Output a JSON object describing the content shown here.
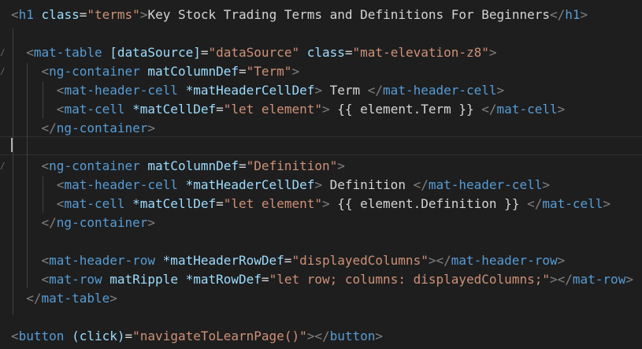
{
  "editor": {
    "theme": {
      "background": "#1e1e1e",
      "tag_color": "#569cd6",
      "attr_color": "#9cdcfe",
      "string_color": "#ce9178",
      "bracket_color": "#808080",
      "text_color": "#d4d4d4"
    },
    "gutter_icon": "fold-chevron-icon",
    "lines": [
      {
        "tokens": [
          {
            "t": "bracket",
            "v": "<"
          },
          {
            "t": "tag",
            "v": "h1"
          },
          {
            "t": "text",
            "v": " "
          },
          {
            "t": "attr",
            "v": "class"
          },
          {
            "t": "text",
            "v": "="
          },
          {
            "t": "str",
            "v": "\"terms\""
          },
          {
            "t": "bracket",
            "v": ">"
          },
          {
            "t": "text",
            "v": "Key Stock Trading Terms and Definitions For Beginners"
          },
          {
            "t": "bracket",
            "v": "</"
          },
          {
            "t": "tag",
            "v": "h1"
          },
          {
            "t": "bracket",
            "v": ">"
          }
        ]
      },
      {
        "tokens": []
      },
      {
        "tokens": [
          {
            "t": "text",
            "v": "  "
          },
          {
            "t": "bracket",
            "v": "<"
          },
          {
            "t": "tag",
            "v": "mat-table"
          },
          {
            "t": "text",
            "v": " "
          },
          {
            "t": "attr",
            "v": "[dataSource]"
          },
          {
            "t": "text",
            "v": "="
          },
          {
            "t": "str",
            "v": "\"dataSource\""
          },
          {
            "t": "text",
            "v": " "
          },
          {
            "t": "attr",
            "v": "class"
          },
          {
            "t": "text",
            "v": "="
          },
          {
            "t": "str",
            "v": "\"mat-elevation-z8\""
          },
          {
            "t": "bracket",
            "v": ">"
          }
        ]
      },
      {
        "tokens": [
          {
            "t": "text",
            "v": "    "
          },
          {
            "t": "bracket",
            "v": "<"
          },
          {
            "t": "tag",
            "v": "ng-container"
          },
          {
            "t": "text",
            "v": " "
          },
          {
            "t": "attr",
            "v": "matColumnDef"
          },
          {
            "t": "text",
            "v": "="
          },
          {
            "t": "str",
            "v": "\"Term\""
          },
          {
            "t": "bracket",
            "v": ">"
          }
        ]
      },
      {
        "tokens": [
          {
            "t": "text",
            "v": "      "
          },
          {
            "t": "bracket",
            "v": "<"
          },
          {
            "t": "tag",
            "v": "mat-header-cell"
          },
          {
            "t": "text",
            "v": " "
          },
          {
            "t": "attr",
            "v": "*matHeaderCellDef"
          },
          {
            "t": "bracket",
            "v": ">"
          },
          {
            "t": "text",
            "v": " Term "
          },
          {
            "t": "bracket",
            "v": "</"
          },
          {
            "t": "tag",
            "v": "mat-header-cell"
          },
          {
            "t": "bracket",
            "v": ">"
          }
        ]
      },
      {
        "tokens": [
          {
            "t": "text",
            "v": "      "
          },
          {
            "t": "bracket",
            "v": "<"
          },
          {
            "t": "tag",
            "v": "mat-cell"
          },
          {
            "t": "text",
            "v": " "
          },
          {
            "t": "attr",
            "v": "*matCellDef"
          },
          {
            "t": "text",
            "v": "="
          },
          {
            "t": "str",
            "v": "\"let element\""
          },
          {
            "t": "bracket",
            "v": ">"
          },
          {
            "t": "text",
            "v": " {{ element.Term }} "
          },
          {
            "t": "bracket",
            "v": "</"
          },
          {
            "t": "tag",
            "v": "mat-cell"
          },
          {
            "t": "bracket",
            "v": ">"
          }
        ]
      },
      {
        "tokens": [
          {
            "t": "text",
            "v": "    "
          },
          {
            "t": "bracket",
            "v": "</"
          },
          {
            "t": "tag",
            "v": "ng-container"
          },
          {
            "t": "bracket",
            "v": ">"
          }
        ]
      },
      {
        "tokens": []
      },
      {
        "tokens": [
          {
            "t": "text",
            "v": "    "
          },
          {
            "t": "bracket",
            "v": "<"
          },
          {
            "t": "tag",
            "v": "ng-container"
          },
          {
            "t": "text",
            "v": " "
          },
          {
            "t": "attr",
            "v": "matColumnDef"
          },
          {
            "t": "text",
            "v": "="
          },
          {
            "t": "str",
            "v": "\"Definition\""
          },
          {
            "t": "bracket",
            "v": ">"
          }
        ]
      },
      {
        "tokens": [
          {
            "t": "text",
            "v": "      "
          },
          {
            "t": "bracket",
            "v": "<"
          },
          {
            "t": "tag",
            "v": "mat-header-cell"
          },
          {
            "t": "text",
            "v": " "
          },
          {
            "t": "attr",
            "v": "*matHeaderCellDef"
          },
          {
            "t": "bracket",
            "v": ">"
          },
          {
            "t": "text",
            "v": " Definition "
          },
          {
            "t": "bracket",
            "v": "</"
          },
          {
            "t": "tag",
            "v": "mat-header-cell"
          },
          {
            "t": "bracket",
            "v": ">"
          }
        ]
      },
      {
        "tokens": [
          {
            "t": "text",
            "v": "      "
          },
          {
            "t": "bracket",
            "v": "<"
          },
          {
            "t": "tag",
            "v": "mat-cell"
          },
          {
            "t": "text",
            "v": " "
          },
          {
            "t": "attr",
            "v": "*matCellDef"
          },
          {
            "t": "text",
            "v": "="
          },
          {
            "t": "str",
            "v": "\"let element\""
          },
          {
            "t": "bracket",
            "v": ">"
          },
          {
            "t": "text",
            "v": " {{ element.Definition }} "
          },
          {
            "t": "bracket",
            "v": "</"
          },
          {
            "t": "tag",
            "v": "mat-cell"
          },
          {
            "t": "bracket",
            "v": ">"
          }
        ]
      },
      {
        "tokens": [
          {
            "t": "text",
            "v": "    "
          },
          {
            "t": "bracket",
            "v": "</"
          },
          {
            "t": "tag",
            "v": "ng-container"
          },
          {
            "t": "bracket",
            "v": ">"
          }
        ]
      },
      {
        "tokens": []
      },
      {
        "tokens": [
          {
            "t": "text",
            "v": "    "
          },
          {
            "t": "bracket",
            "v": "<"
          },
          {
            "t": "tag",
            "v": "mat-header-row"
          },
          {
            "t": "text",
            "v": " "
          },
          {
            "t": "attr",
            "v": "*matHeaderRowDef"
          },
          {
            "t": "text",
            "v": "="
          },
          {
            "t": "str",
            "v": "\"displayedColumns\""
          },
          {
            "t": "bracket",
            "v": "></"
          },
          {
            "t": "tag",
            "v": "mat-header-row"
          },
          {
            "t": "bracket",
            "v": ">"
          }
        ]
      },
      {
        "tokens": [
          {
            "t": "text",
            "v": "    "
          },
          {
            "t": "bracket",
            "v": "<"
          },
          {
            "t": "tag",
            "v": "mat-row"
          },
          {
            "t": "text",
            "v": " "
          },
          {
            "t": "attr",
            "v": "matRipple"
          },
          {
            "t": "text",
            "v": " "
          },
          {
            "t": "attr",
            "v": "*matRowDef"
          },
          {
            "t": "text",
            "v": "="
          },
          {
            "t": "str",
            "v": "\"let row; columns: displayedColumns;\""
          },
          {
            "t": "bracket",
            "v": "></"
          },
          {
            "t": "tag",
            "v": "mat-row"
          },
          {
            "t": "bracket",
            "v": ">"
          }
        ]
      },
      {
        "tokens": [
          {
            "t": "text",
            "v": "  "
          },
          {
            "t": "bracket",
            "v": "</"
          },
          {
            "t": "tag",
            "v": "mat-table"
          },
          {
            "t": "bracket",
            "v": ">"
          }
        ]
      },
      {
        "tokens": []
      },
      {
        "tokens": [
          {
            "t": "bracket",
            "v": "<"
          },
          {
            "t": "tag",
            "v": "button"
          },
          {
            "t": "text",
            "v": " "
          },
          {
            "t": "attr",
            "v": "(click)"
          },
          {
            "t": "text",
            "v": "="
          },
          {
            "t": "str",
            "v": "\"navigateToLearnPage()\""
          },
          {
            "t": "bracket",
            "v": "></"
          },
          {
            "t": "tag",
            "v": "button"
          },
          {
            "t": "bracket",
            "v": ">"
          }
        ]
      }
    ]
  }
}
